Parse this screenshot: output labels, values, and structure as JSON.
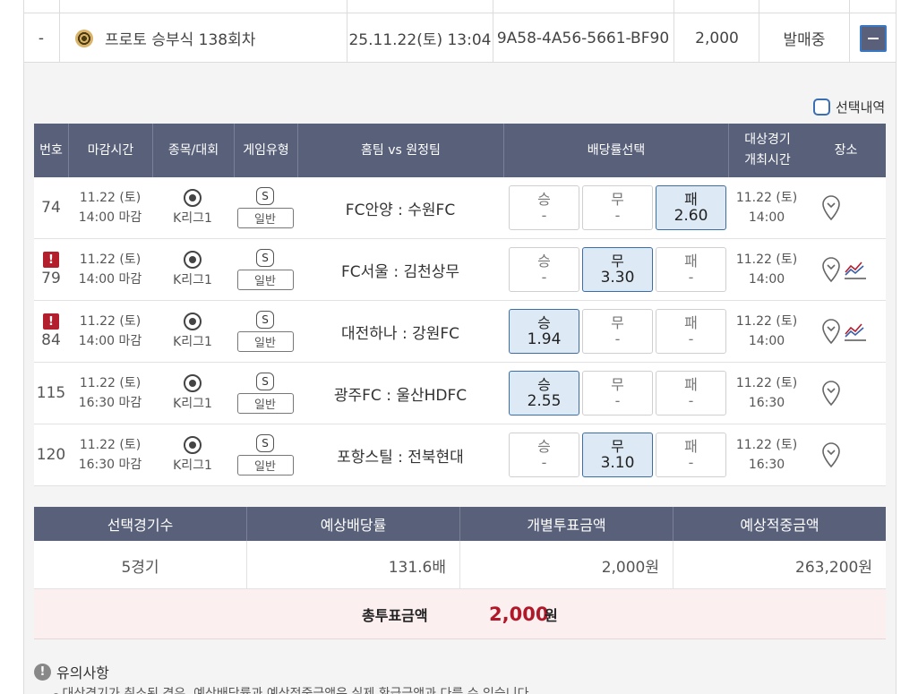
{
  "order": {
    "dash": "-",
    "name": "프로토 승부식 138회차",
    "datetime": "25.11.22(토) 13:04",
    "code": "9A58-4A56-5661-BF90",
    "amount": "2,000",
    "status": "발매중"
  },
  "select_label": "선택내역",
  "headers": {
    "num": "번호",
    "deadline": "마감시간",
    "sport": "종목/대회",
    "type": "게임유형",
    "teams": "홈팀 vs 원정팀",
    "odds": "배당률선택",
    "event_l1": "대상경기",
    "event_l2": "개최시간",
    "place": "장소"
  },
  "games": [
    {
      "num": "74",
      "alert": "",
      "date": "11.22 (토)",
      "deadline": "14:00 마감",
      "league": "K리그1",
      "badge": "S",
      "type": "일반",
      "teams": "FC안양 : 수원FC",
      "odds": [
        {
          "label": "승",
          "value": "-"
        },
        {
          "label": "무",
          "value": "-"
        },
        {
          "label": "패",
          "value": "2.60"
        }
      ],
      "selected": 2,
      "edate": "11.22 (토)",
      "etime": "14:00",
      "trend": false
    },
    {
      "num": "79",
      "alert": "!",
      "date": "11.22 (토)",
      "deadline": "14:00 마감",
      "league": "K리그1",
      "badge": "S",
      "type": "일반",
      "teams": "FC서울 : 김천상무",
      "odds": [
        {
          "label": "승",
          "value": "-"
        },
        {
          "label": "무",
          "value": "3.30"
        },
        {
          "label": "패",
          "value": "-"
        }
      ],
      "selected": 1,
      "edate": "11.22 (토)",
      "etime": "14:00",
      "trend": true
    },
    {
      "num": "84",
      "alert": "!",
      "date": "11.22 (토)",
      "deadline": "14:00 마감",
      "league": "K리그1",
      "badge": "S",
      "type": "일반",
      "teams": "대전하나 : 강원FC",
      "odds": [
        {
          "label": "승",
          "value": "1.94"
        },
        {
          "label": "무",
          "value": "-"
        },
        {
          "label": "패",
          "value": "-"
        }
      ],
      "selected": 0,
      "edate": "11.22 (토)",
      "etime": "14:00",
      "trend": true
    },
    {
      "num": "115",
      "alert": "",
      "date": "11.22 (토)",
      "deadline": "16:30 마감",
      "league": "K리그1",
      "badge": "S",
      "type": "일반",
      "teams": "광주FC : 울산HDFC",
      "odds": [
        {
          "label": "승",
          "value": "2.55"
        },
        {
          "label": "무",
          "value": "-"
        },
        {
          "label": "패",
          "value": "-"
        }
      ],
      "selected": 0,
      "edate": "11.22 (토)",
      "etime": "16:30",
      "trend": false
    },
    {
      "num": "120",
      "alert": "",
      "date": "11.22 (토)",
      "deadline": "16:30 마감",
      "league": "K리그1",
      "badge": "S",
      "type": "일반",
      "teams": "포항스틸 : 전북현대",
      "odds": [
        {
          "label": "승",
          "value": "-"
        },
        {
          "label": "무",
          "value": "3.10"
        },
        {
          "label": "패",
          "value": "-"
        }
      ],
      "selected": 1,
      "edate": "11.22 (토)",
      "etime": "16:30",
      "trend": false
    }
  ],
  "summary": {
    "headers": [
      "선택경기수",
      "예상배당률",
      "개별투표금액",
      "예상적중금액"
    ],
    "values": [
      "5경기",
      "131.6배",
      "2,000원",
      "263,200원"
    ],
    "total_label": "총투표금액",
    "total_value": "2,000",
    "total_unit": "원"
  },
  "notice": {
    "title": "유의사항",
    "line": "- 대상경기가 취소된 경우, 예상배당률과 예상적중금액은 실제 환급금액과 다를 수 있습니다."
  },
  "colors": {
    "header": "#59607a",
    "selected": "#dde9f4",
    "accent": "#b0182a"
  }
}
